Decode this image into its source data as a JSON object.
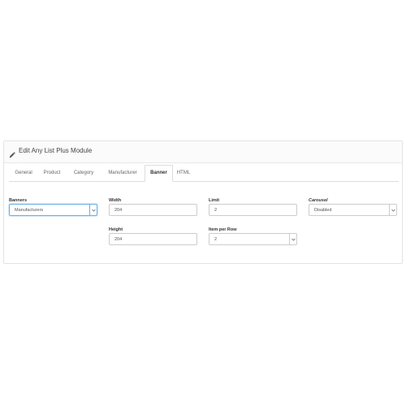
{
  "panel": {
    "title": "Edit Any List Plus Module",
    "title_icon": "pencil-icon"
  },
  "tabs": [
    {
      "label": "General"
    },
    {
      "label": "Product"
    },
    {
      "label": "Category"
    },
    {
      "label": "Manufacturer"
    },
    {
      "label": "Banner",
      "active": true
    },
    {
      "label": "HTML"
    }
  ],
  "form": {
    "banners": {
      "label": "Banners",
      "value": "Manufacturers"
    },
    "width": {
      "label": "Width",
      "value": "204"
    },
    "height": {
      "label": "Height",
      "value": "204"
    },
    "limit": {
      "label": "Limit",
      "value": "2"
    },
    "item_per_row": {
      "label": "Item per Row",
      "value": "2"
    },
    "carousel": {
      "label": "Carousel",
      "value": "Disabled"
    }
  }
}
